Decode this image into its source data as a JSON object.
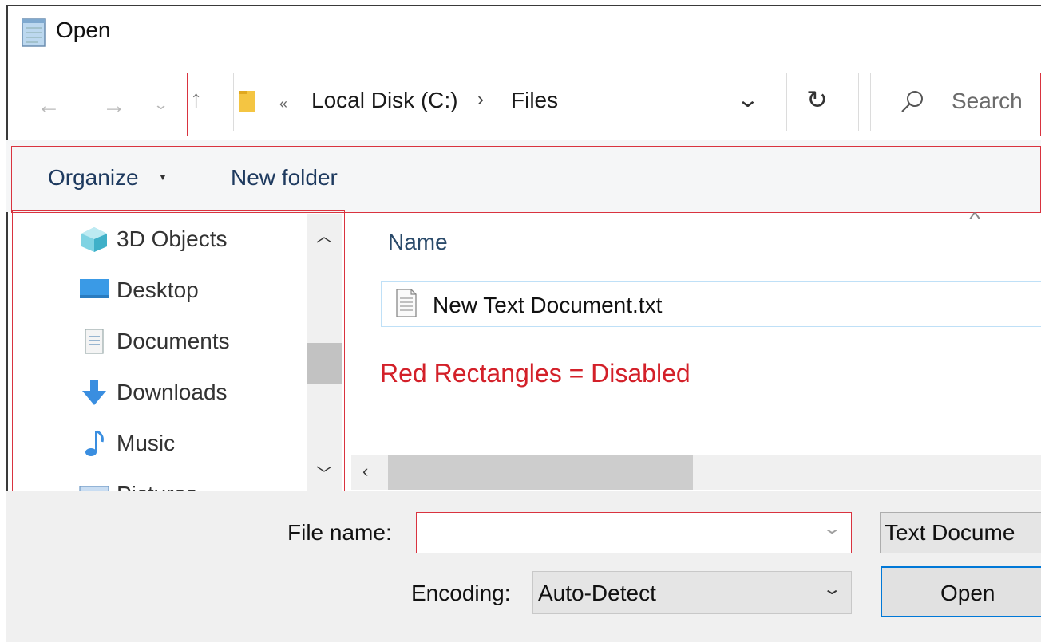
{
  "window": {
    "title": "Open"
  },
  "addressbar": {
    "breadcrumb_overflow": "«",
    "crumbs": [
      "Local Disk (C:)",
      "Files"
    ],
    "crumb_separator": "›",
    "search_placeholder": "Search"
  },
  "toolbar": {
    "organize_label": "Organize",
    "new_folder_label": "New folder"
  },
  "nav_pane": {
    "items": [
      {
        "label": "3D Objects",
        "icon": "3d-objects-icon"
      },
      {
        "label": "Desktop",
        "icon": "desktop-icon"
      },
      {
        "label": "Documents",
        "icon": "documents-icon"
      },
      {
        "label": "Downloads",
        "icon": "downloads-icon"
      },
      {
        "label": "Music",
        "icon": "music-icon"
      },
      {
        "label": "Pictures",
        "icon": "pictures-icon"
      }
    ]
  },
  "file_list": {
    "column_name": "Name",
    "files": [
      {
        "name": "New Text Document.txt",
        "icon": "text-file-icon"
      }
    ]
  },
  "annotation": {
    "text": "Red Rectangles = Disabled",
    "color": "#d32029"
  },
  "bottom": {
    "file_name_label": "File name:",
    "file_name_value": "",
    "file_type_value": "Text Docume",
    "encoding_label": "Encoding:",
    "encoding_value": "Auto-Detect",
    "open_label": "Open"
  },
  "colors": {
    "disabled_outline": "#d9333f",
    "accent": "#0078d7"
  }
}
